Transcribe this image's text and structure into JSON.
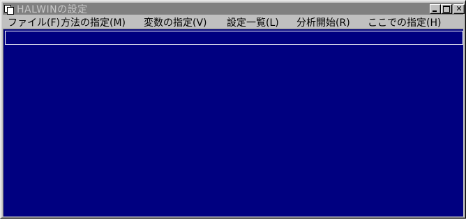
{
  "window": {
    "title": "HALWINの設定",
    "controls": {
      "minimize": "minimize",
      "maximize": "maximize",
      "close": "✕"
    }
  },
  "menu": {
    "items": [
      {
        "label": "ファイル(F)"
      },
      {
        "label": "方法の指定(M)"
      },
      {
        "label": "変数の指定(V)"
      },
      {
        "label": "設定一覧(L)"
      },
      {
        "label": "分析開始(R)"
      },
      {
        "label": "ここでの指定(H)"
      }
    ]
  },
  "content": {
    "field_value": ""
  },
  "colors": {
    "titlebar_inactive": "#808080",
    "title_text": "#c8c8c8",
    "client_background": "#000080",
    "field_border": "#ffffff",
    "chrome": "#c0c0c0"
  },
  "icons": {
    "app": "app-window-icon",
    "minimize": "minimize-icon",
    "maximize": "maximize-icon",
    "close": "close-icon"
  }
}
